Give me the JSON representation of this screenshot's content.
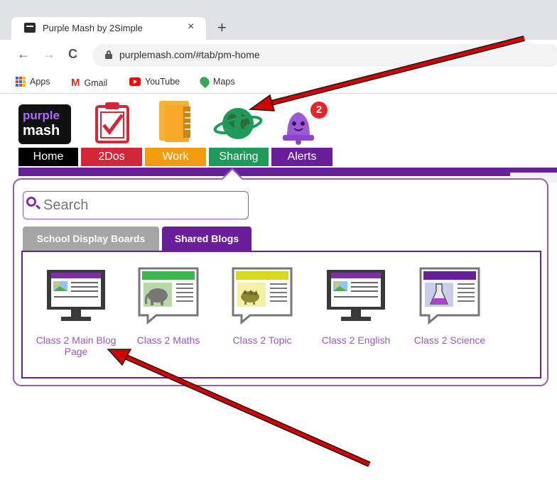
{
  "browser": {
    "tab_title": "Purple Mash by 2Simple",
    "tab_close": "×",
    "new_tab": "+",
    "url": "purplemash.com/#tab/pm-home",
    "back": "←",
    "forward": "→",
    "reload": "C",
    "bookmarks": [
      "Apps",
      "Gmail",
      "YouTube",
      "Maps"
    ]
  },
  "logo": {
    "line1": "purple",
    "line2": "mash"
  },
  "alerts_count": "2",
  "nav_tabs": [
    {
      "label": "Home",
      "color": "#000000"
    },
    {
      "label": "2Dos",
      "color": "#d3283a"
    },
    {
      "label": "Work",
      "color": "#f39c12"
    },
    {
      "label": "Sharing",
      "color": "#1f9a5b"
    },
    {
      "label": "Alerts",
      "color": "#6a1f9a"
    }
  ],
  "sharing_panel": {
    "search_placeholder": "Search",
    "tabs": [
      {
        "label": "School Display Boards",
        "color": "#a5a5a5"
      },
      {
        "label": "Shared Blogs",
        "color": "#6a1f9a",
        "active": true
      }
    ],
    "blogs": [
      {
        "label": "Class 2 Main Blog Page",
        "icon": "monitor-icon"
      },
      {
        "label": "Class 2 Maths",
        "icon": "elephant-blog-icon"
      },
      {
        "label": "Class 2 Topic",
        "icon": "dinosaur-blog-icon"
      },
      {
        "label": "Class 2 English",
        "icon": "monitor-icon"
      },
      {
        "label": "Class 2 Science",
        "icon": "flask-blog-icon"
      }
    ]
  },
  "colors": {
    "accent": "#6a1f9a",
    "annotation_arrow": "#d40000"
  }
}
